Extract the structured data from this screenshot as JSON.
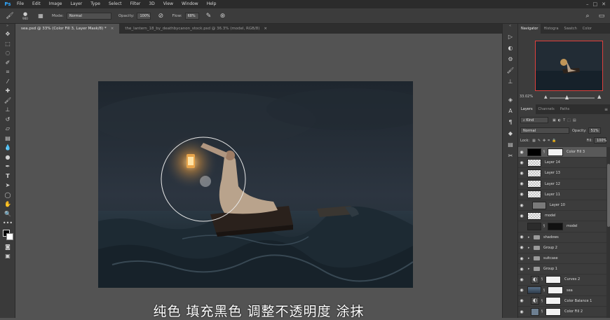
{
  "app": {
    "logo": "Ps"
  },
  "menu": [
    "File",
    "Edit",
    "Image",
    "Layer",
    "Type",
    "Select",
    "Filter",
    "3D",
    "View",
    "Window",
    "Help"
  ],
  "options": {
    "brush_size": "900",
    "mode_label": "Mode:",
    "mode_value": "Normal",
    "opacity_label": "Opacity:",
    "opacity_value": "100%",
    "flow_label": "Flow:",
    "flow_value": "68%"
  },
  "tabs": [
    {
      "label": "sea.psd @ 33% (Color Fill 3, Layer Mask/8) *",
      "active": true
    },
    {
      "label": "the_lantern_18_by_deathbycanon_stock.psd @ 36.3% (model, RGB/8)",
      "active": false
    }
  ],
  "caption": "纯色  填充黑色  调整不透明度  涂抹",
  "navigator": {
    "tabs": [
      "Navigator",
      "Histogra",
      "Swatch",
      "Color"
    ],
    "zoom": "33.02%"
  },
  "layers_panel": {
    "tabs": [
      "Layers",
      "Channels",
      "Paths"
    ],
    "filter_value": "Kind",
    "blend_mode": "Normal",
    "opacity_label": "Opacity:",
    "opacity_value": "51%",
    "lock_label": "Lock:",
    "fill_label": "Fill:",
    "fill_value": "100%",
    "layers": [
      {
        "name": "Color Fill 3",
        "visible": true,
        "selected": true,
        "kind": "fill-black"
      },
      {
        "name": "Layer 14",
        "visible": true,
        "kind": "pixel"
      },
      {
        "name": "Layer 13",
        "visible": true,
        "kind": "pixel"
      },
      {
        "name": "Layer 12",
        "visible": true,
        "kind": "pixel"
      },
      {
        "name": "Layer 11",
        "visible": true,
        "kind": "pixel"
      },
      {
        "name": "Layer 10",
        "visible": true,
        "kind": "gray"
      },
      {
        "name": "model",
        "visible": true,
        "kind": "pixel"
      },
      {
        "name": "model",
        "visible": false,
        "kind": "masked"
      },
      {
        "name": "shadows",
        "visible": true,
        "kind": "folder"
      },
      {
        "name": "Group 2",
        "visible": true,
        "kind": "folder"
      },
      {
        "name": "suitcase",
        "visible": true,
        "kind": "folder"
      },
      {
        "name": "Group 1",
        "visible": true,
        "kind": "folder"
      },
      {
        "name": "Curves 2",
        "visible": true,
        "kind": "adjust"
      },
      {
        "name": "sea",
        "visible": true,
        "kind": "sea"
      },
      {
        "name": "Color Balance 1",
        "visible": true,
        "kind": "adjust"
      },
      {
        "name": "Color Fill 2",
        "visible": true,
        "kind": "fill-blue"
      }
    ]
  },
  "colors": {
    "accent_nav_frame": "#e0403c",
    "ps_blue": "#31a8ff"
  }
}
